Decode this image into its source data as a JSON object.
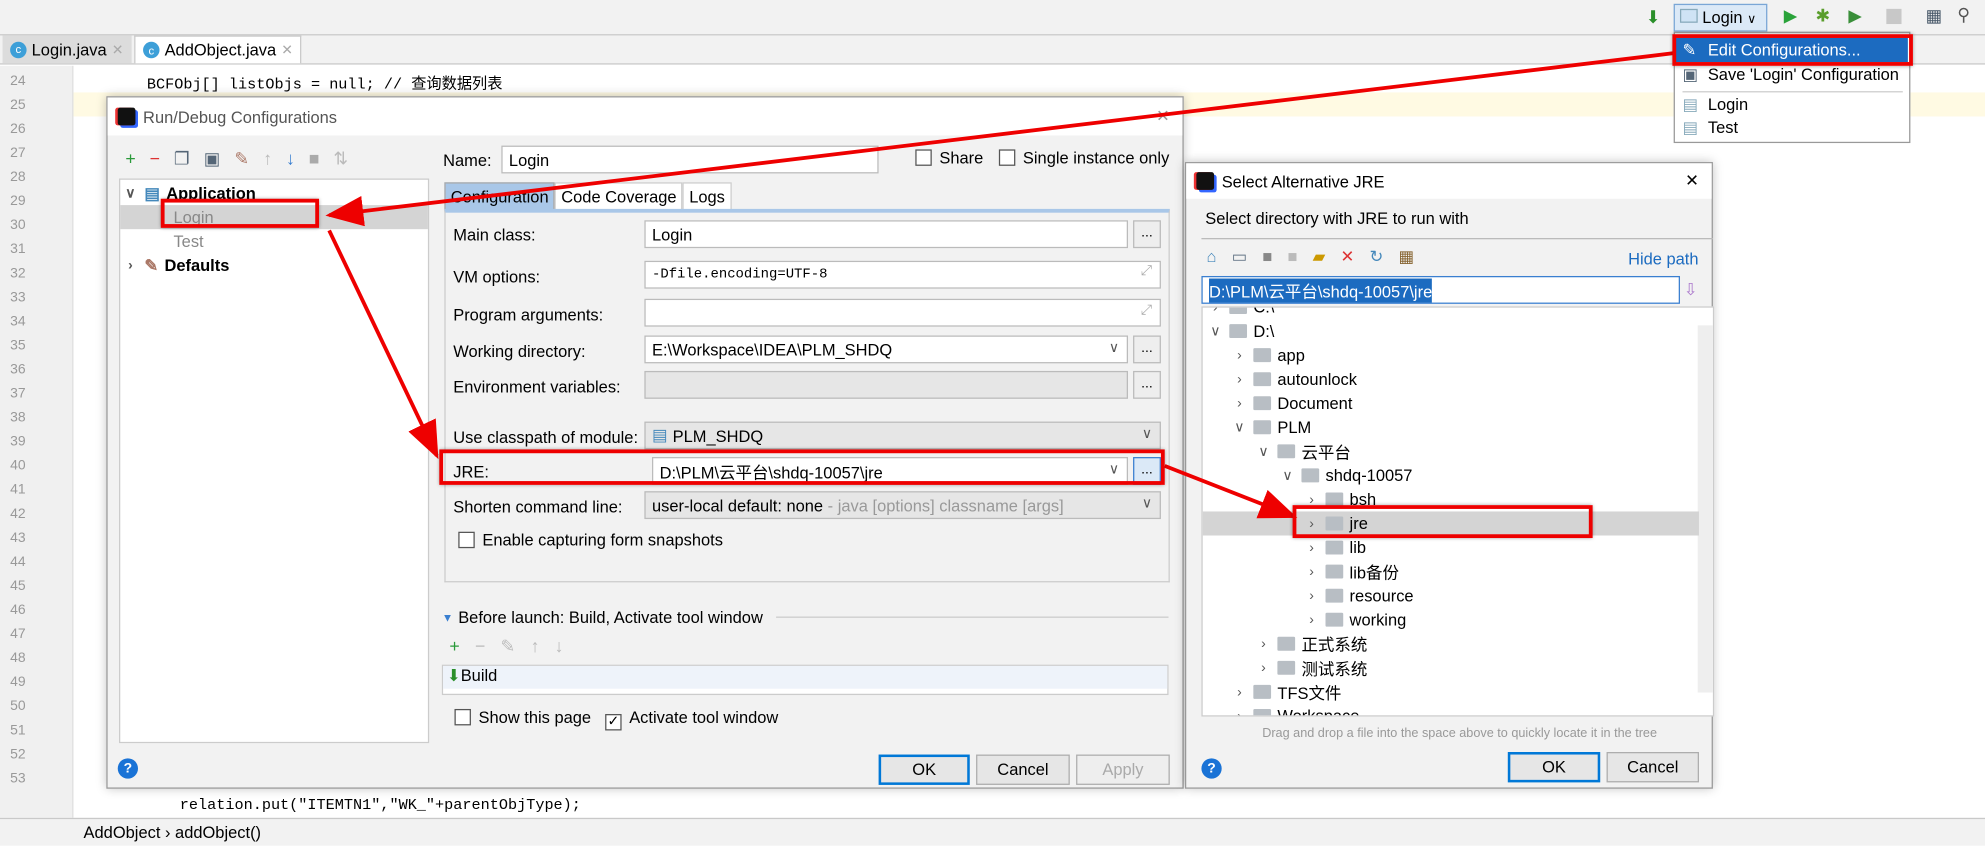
{
  "toolbar": {
    "run_config": "Login",
    "icons": [
      "build-icon",
      "run-icon",
      "debug-icon",
      "coverage-icon",
      "stop-icon",
      "project-structure-icon",
      "search-icon"
    ]
  },
  "run_menu": {
    "items": [
      "Edit Configurations...",
      "Save 'Login' Configuration",
      "Login",
      "Test"
    ],
    "selected": "Edit Configurations..."
  },
  "editor": {
    "tabs": [
      {
        "label": "Login.java"
      },
      {
        "label": "AddObject.java",
        "active": true
      }
    ],
    "line_numbers": [
      "24",
      "25",
      "26",
      "27",
      "28",
      "29",
      "30",
      "31",
      "32",
      "33",
      "34",
      "35",
      "36",
      "37",
      "38",
      "39",
      "40",
      "41",
      "42",
      "43",
      "44",
      "45",
      "46",
      "47",
      "48",
      "49",
      "50",
      "51",
      "52",
      "53"
    ],
    "code_top": "BCFObj[] listObjs = null;   // 查询数据列表",
    "code_bottom": "relation.put(\"ITEMTN1\",\"WK_\"+parentObjType);",
    "breadcrumb": [
      "AddObject",
      "addObject()"
    ]
  },
  "run_dialog": {
    "title": "Run/Debug Configurations",
    "tree": {
      "application": "Application",
      "login": "Login",
      "test": "Test",
      "defaults": "Defaults"
    },
    "name_label": "Name:",
    "name_value": "Login",
    "share": "Share",
    "single_instance": "Single instance only",
    "tabs": [
      "Configuration",
      "Code Coverage",
      "Logs"
    ],
    "fields": {
      "main_class": {
        "label": "Main class:",
        "value": "Login"
      },
      "vm_options": {
        "label": "VM options:",
        "value": "-Dfile.encoding=UTF-8"
      },
      "program_arguments": {
        "label": "Program arguments:",
        "value": ""
      },
      "working_directory": {
        "label": "Working directory:",
        "value": "E:\\Workspace\\IDEA\\PLM_SHDQ"
      },
      "environment_variables": {
        "label": "Environment variables:",
        "value": ""
      },
      "classpath_module": {
        "label": "Use classpath of module:",
        "value": "PLM_SHDQ"
      },
      "jre": {
        "label": "JRE:",
        "value": "D:\\PLM\\云平台\\shdq-10057\\jre"
      },
      "shorten_command_line": {
        "label": "Shorten command line:",
        "value": "user-local default: none",
        "hint": "- java [options] classname [args]"
      }
    },
    "enable_snapshots": "Enable capturing form snapshots",
    "before_launch": "Before launch: Build, Activate tool window",
    "build_item": "Build",
    "show_this_page": "Show this page",
    "activate_tool_window": "Activate tool window",
    "buttons": {
      "ok": "OK",
      "cancel": "Cancel",
      "apply": "Apply"
    }
  },
  "jre_dialog": {
    "title": "Select Alternative JRE",
    "subtitle": "Select directory with JRE to run with",
    "hide_path": "Hide path",
    "path": "D:\\PLM\\云平台\\shdq-10057\\jre",
    "tree": [
      {
        "label": "C:\\",
        "depth": 0,
        "open": false
      },
      {
        "label": "D:\\",
        "depth": 0,
        "open": true
      },
      {
        "label": "app",
        "depth": 1
      },
      {
        "label": "autounlock",
        "depth": 1
      },
      {
        "label": "Document",
        "depth": 1
      },
      {
        "label": "PLM",
        "depth": 1,
        "open": true
      },
      {
        "label": "云平台",
        "depth": 2,
        "open": true
      },
      {
        "label": "shdq-10057",
        "depth": 3,
        "open": true
      },
      {
        "label": "bsh",
        "depth": 4
      },
      {
        "label": "jre",
        "depth": 4,
        "selected": true
      },
      {
        "label": "lib",
        "depth": 4
      },
      {
        "label": "lib备份",
        "depth": 4
      },
      {
        "label": "resource",
        "depth": 4
      },
      {
        "label": "working",
        "depth": 4
      },
      {
        "label": "正式系统",
        "depth": 2
      },
      {
        "label": "测试系统",
        "depth": 2
      },
      {
        "label": "TFS文件",
        "depth": 1
      },
      {
        "label": "Workspace",
        "depth": 1
      }
    ],
    "hint": "Drag and drop a file into the space above to quickly locate it in the tree",
    "buttons": {
      "ok": "OK",
      "cancel": "Cancel"
    }
  },
  "colors": {
    "annotation": "#e00000",
    "selection": "#1c6bc0",
    "accent": "#0078d7"
  }
}
